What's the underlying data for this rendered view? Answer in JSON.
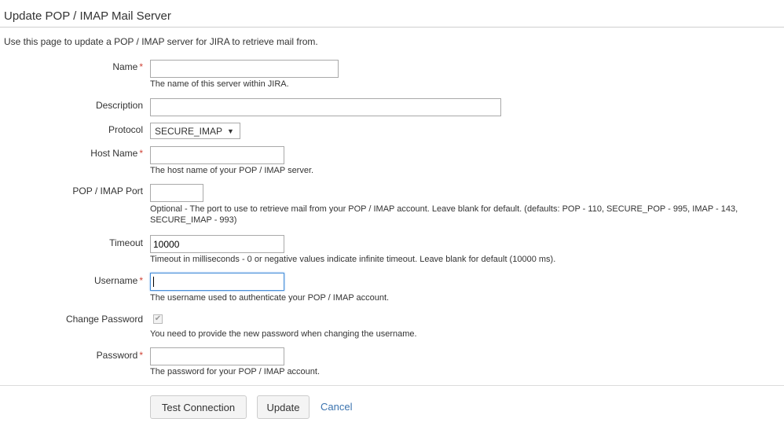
{
  "page": {
    "title": "Update POP / IMAP Mail Server",
    "description": "Use this page to update a POP / IMAP server for JIRA to retrieve mail from."
  },
  "form": {
    "required_marker": "*",
    "name": {
      "label": "Name",
      "value": "",
      "help": "The name of this server within JIRA."
    },
    "description": {
      "label": "Description",
      "value": ""
    },
    "protocol": {
      "label": "Protocol",
      "selected": "SECURE_IMAP"
    },
    "host": {
      "label": "Host Name",
      "value": "",
      "help": "The host name of your POP / IMAP server."
    },
    "port": {
      "label": "POP / IMAP Port",
      "value": "",
      "help_line1": "Optional - The port to use to retrieve mail from your POP / IMAP account. Leave blank for default. (defaults: POP - 110, SECURE_POP - 995, IMAP - 143,",
      "help_line2": "SECURE_IMAP - 993)"
    },
    "timeout": {
      "label": "Timeout",
      "value": "10000",
      "help": "Timeout in milliseconds - 0 or negative values indicate infinite timeout. Leave blank for default (10000 ms)."
    },
    "username": {
      "label": "Username",
      "value": "",
      "help": "The username used to authenticate your POP / IMAP account."
    },
    "change_password": {
      "label": "Change Password",
      "checked": true,
      "check_glyph": "✔",
      "help": "You need to provide the new password when changing the username."
    },
    "password": {
      "label": "Password",
      "value": "",
      "help": "The password for your POP / IMAP account."
    }
  },
  "actions": {
    "test_connection": "Test Connection",
    "update": "Update",
    "cancel": "Cancel"
  },
  "icons": {
    "caret": "▼"
  },
  "colors": {
    "required": "#d04437",
    "link": "#3b73af",
    "focus": "#4a90d9"
  }
}
